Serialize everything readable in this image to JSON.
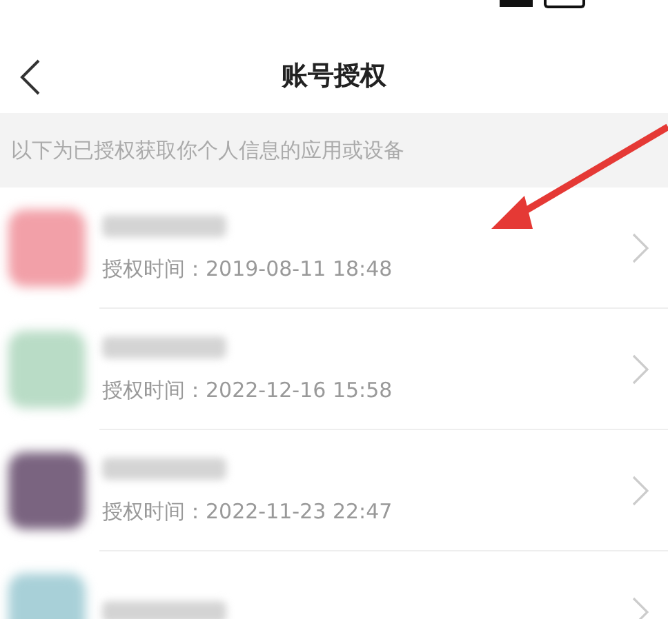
{
  "nav": {
    "title": "账号授权"
  },
  "notice": "以下为已授权获取你个人信息的应用或设备",
  "apps": [
    {
      "color": "#f2a0a8",
      "time": "授权时间：2019-08-11 18:48"
    },
    {
      "color": "#b9dcc6",
      "time": "授权时间：2022-12-16 15:58"
    },
    {
      "color": "#7a6480",
      "time": "授权时间：2022-11-23 22:47"
    },
    {
      "color": "#a8d0d8"
    }
  ]
}
